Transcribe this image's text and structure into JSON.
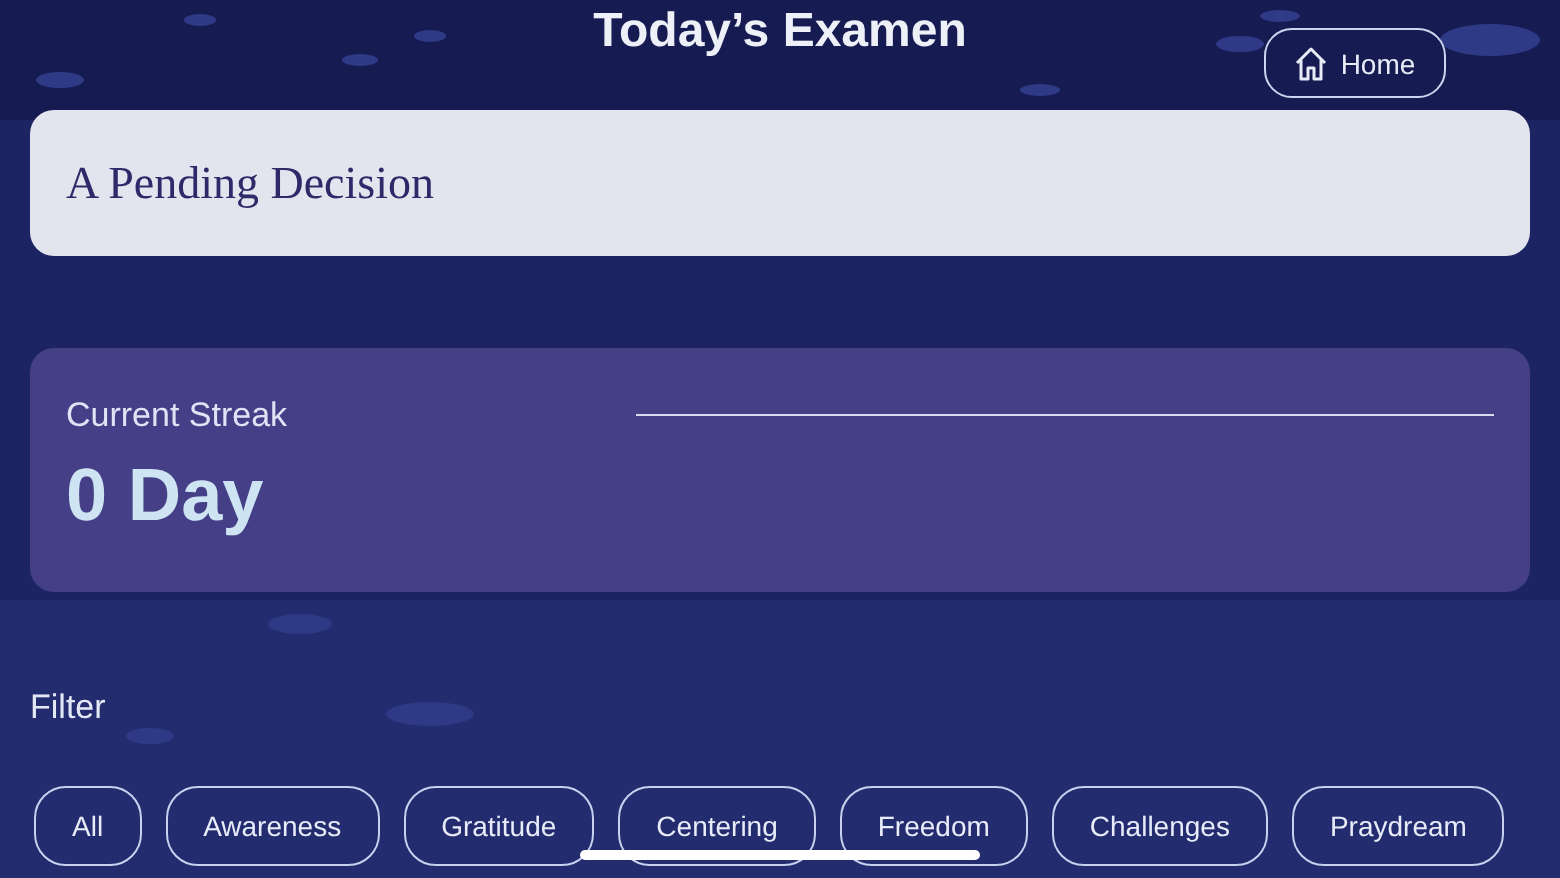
{
  "header": {
    "title": "Today’s Examen",
    "home_button": "Home"
  },
  "prompt_card": {
    "text": "A Pending Decision"
  },
  "streak": {
    "label": "Current Streak",
    "value": "0 Day"
  },
  "filter": {
    "label": "Filter",
    "chips": [
      "All",
      "Awareness",
      "Gratitude",
      "Centering",
      "Freedom",
      "Challenges",
      "Praydream"
    ]
  }
}
